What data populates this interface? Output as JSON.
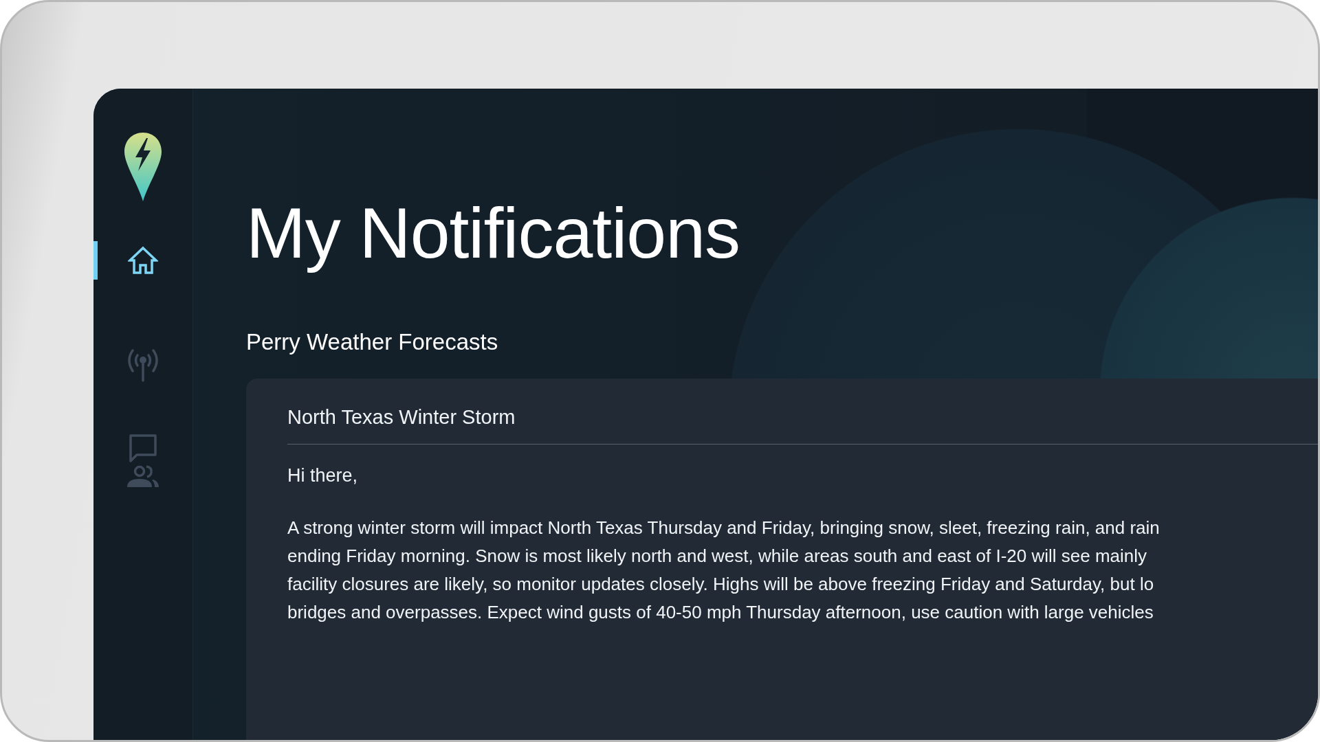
{
  "sidebar": {
    "items": [
      {
        "kind": "home",
        "selected": true
      },
      {
        "kind": "broadcast",
        "selected": false
      },
      {
        "kind": "messages",
        "selected": false
      }
    ]
  },
  "page": {
    "title": "My Notifications",
    "section": "Perry Weather Forecasts"
  },
  "notification": {
    "title": "North Texas Winter Storm",
    "greeting": "Hi there,",
    "body_lines": [
      "A strong winter storm will impact North Texas Thursday and Friday, bringing snow, sleet, freezing rain, and rain",
      "ending Friday morning. Snow is most likely north and west, while areas south and east of I-20 will see mainly",
      "facility closures are likely, so monitor updates closely. Highs will be above freezing Friday and Saturday, but lo",
      "bridges and overpasses. Expect wind gusts of 40-50 mph Thursday afternoon, use caution with large vehicles"
    ]
  }
}
